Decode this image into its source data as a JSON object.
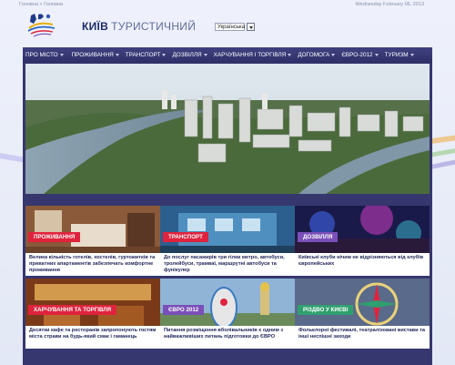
{
  "breadcrumb": {
    "home": "Головна",
    "separator": " > ",
    "current": "Головна"
  },
  "date": "Wednesday February 06, 2013",
  "brand": {
    "name": "КИЇВ",
    "subtitle": "ТУРИСТИЧНИЙ"
  },
  "language": {
    "selected": "Українська"
  },
  "nav": [
    {
      "label": "Про місто"
    },
    {
      "label": "Проживання"
    },
    {
      "label": "Транспорт"
    },
    {
      "label": "Дозвілля"
    },
    {
      "label": "Харчування і торгівля"
    },
    {
      "label": "Догомога"
    },
    {
      "label": "Євро-2012"
    },
    {
      "label": "Туризм"
    }
  ],
  "tiles": [
    {
      "label": "ПРОЖИВАННЯ",
      "label_color": "#e0233d",
      "caption": "Велика кількість готелів, хостелів, гуртожитків та приватних апартаментів забезпечать комфортне проживання"
    },
    {
      "label": "ТРАНСПОРТ",
      "label_color": "#e0233d",
      "caption": "До послуг пасажирів три гілки метро, автобуси, тролейбуси, трамваї, маршрутні автобуси та фунікулер"
    },
    {
      "label": "ДОЗВІЛЛЯ",
      "label_color": "#7a4fb8",
      "caption": "Київські клуби нічим не відрізняються від клубів європейських"
    },
    {
      "label": "ХАРЧУВАННЯ та ТОРГІВЛЯ",
      "label_color": "#e0233d",
      "caption": "Десятки кафе та ресторанів запропонують гостям міста страви на будь-який смак і гаманець"
    },
    {
      "label": "ЄВРО 2012",
      "label_color": "#7a4fb8",
      "caption": "Питання розміщення вболівальників є одним з найважливіших питань підготовки до ЄВРО"
    },
    {
      "label": "РІЗДВО У КИЄВІ",
      "label_color": "#2fa06e",
      "caption": "Фольклорні фестивалі, театралізовані вистави та інші неспішні заходи"
    }
  ]
}
